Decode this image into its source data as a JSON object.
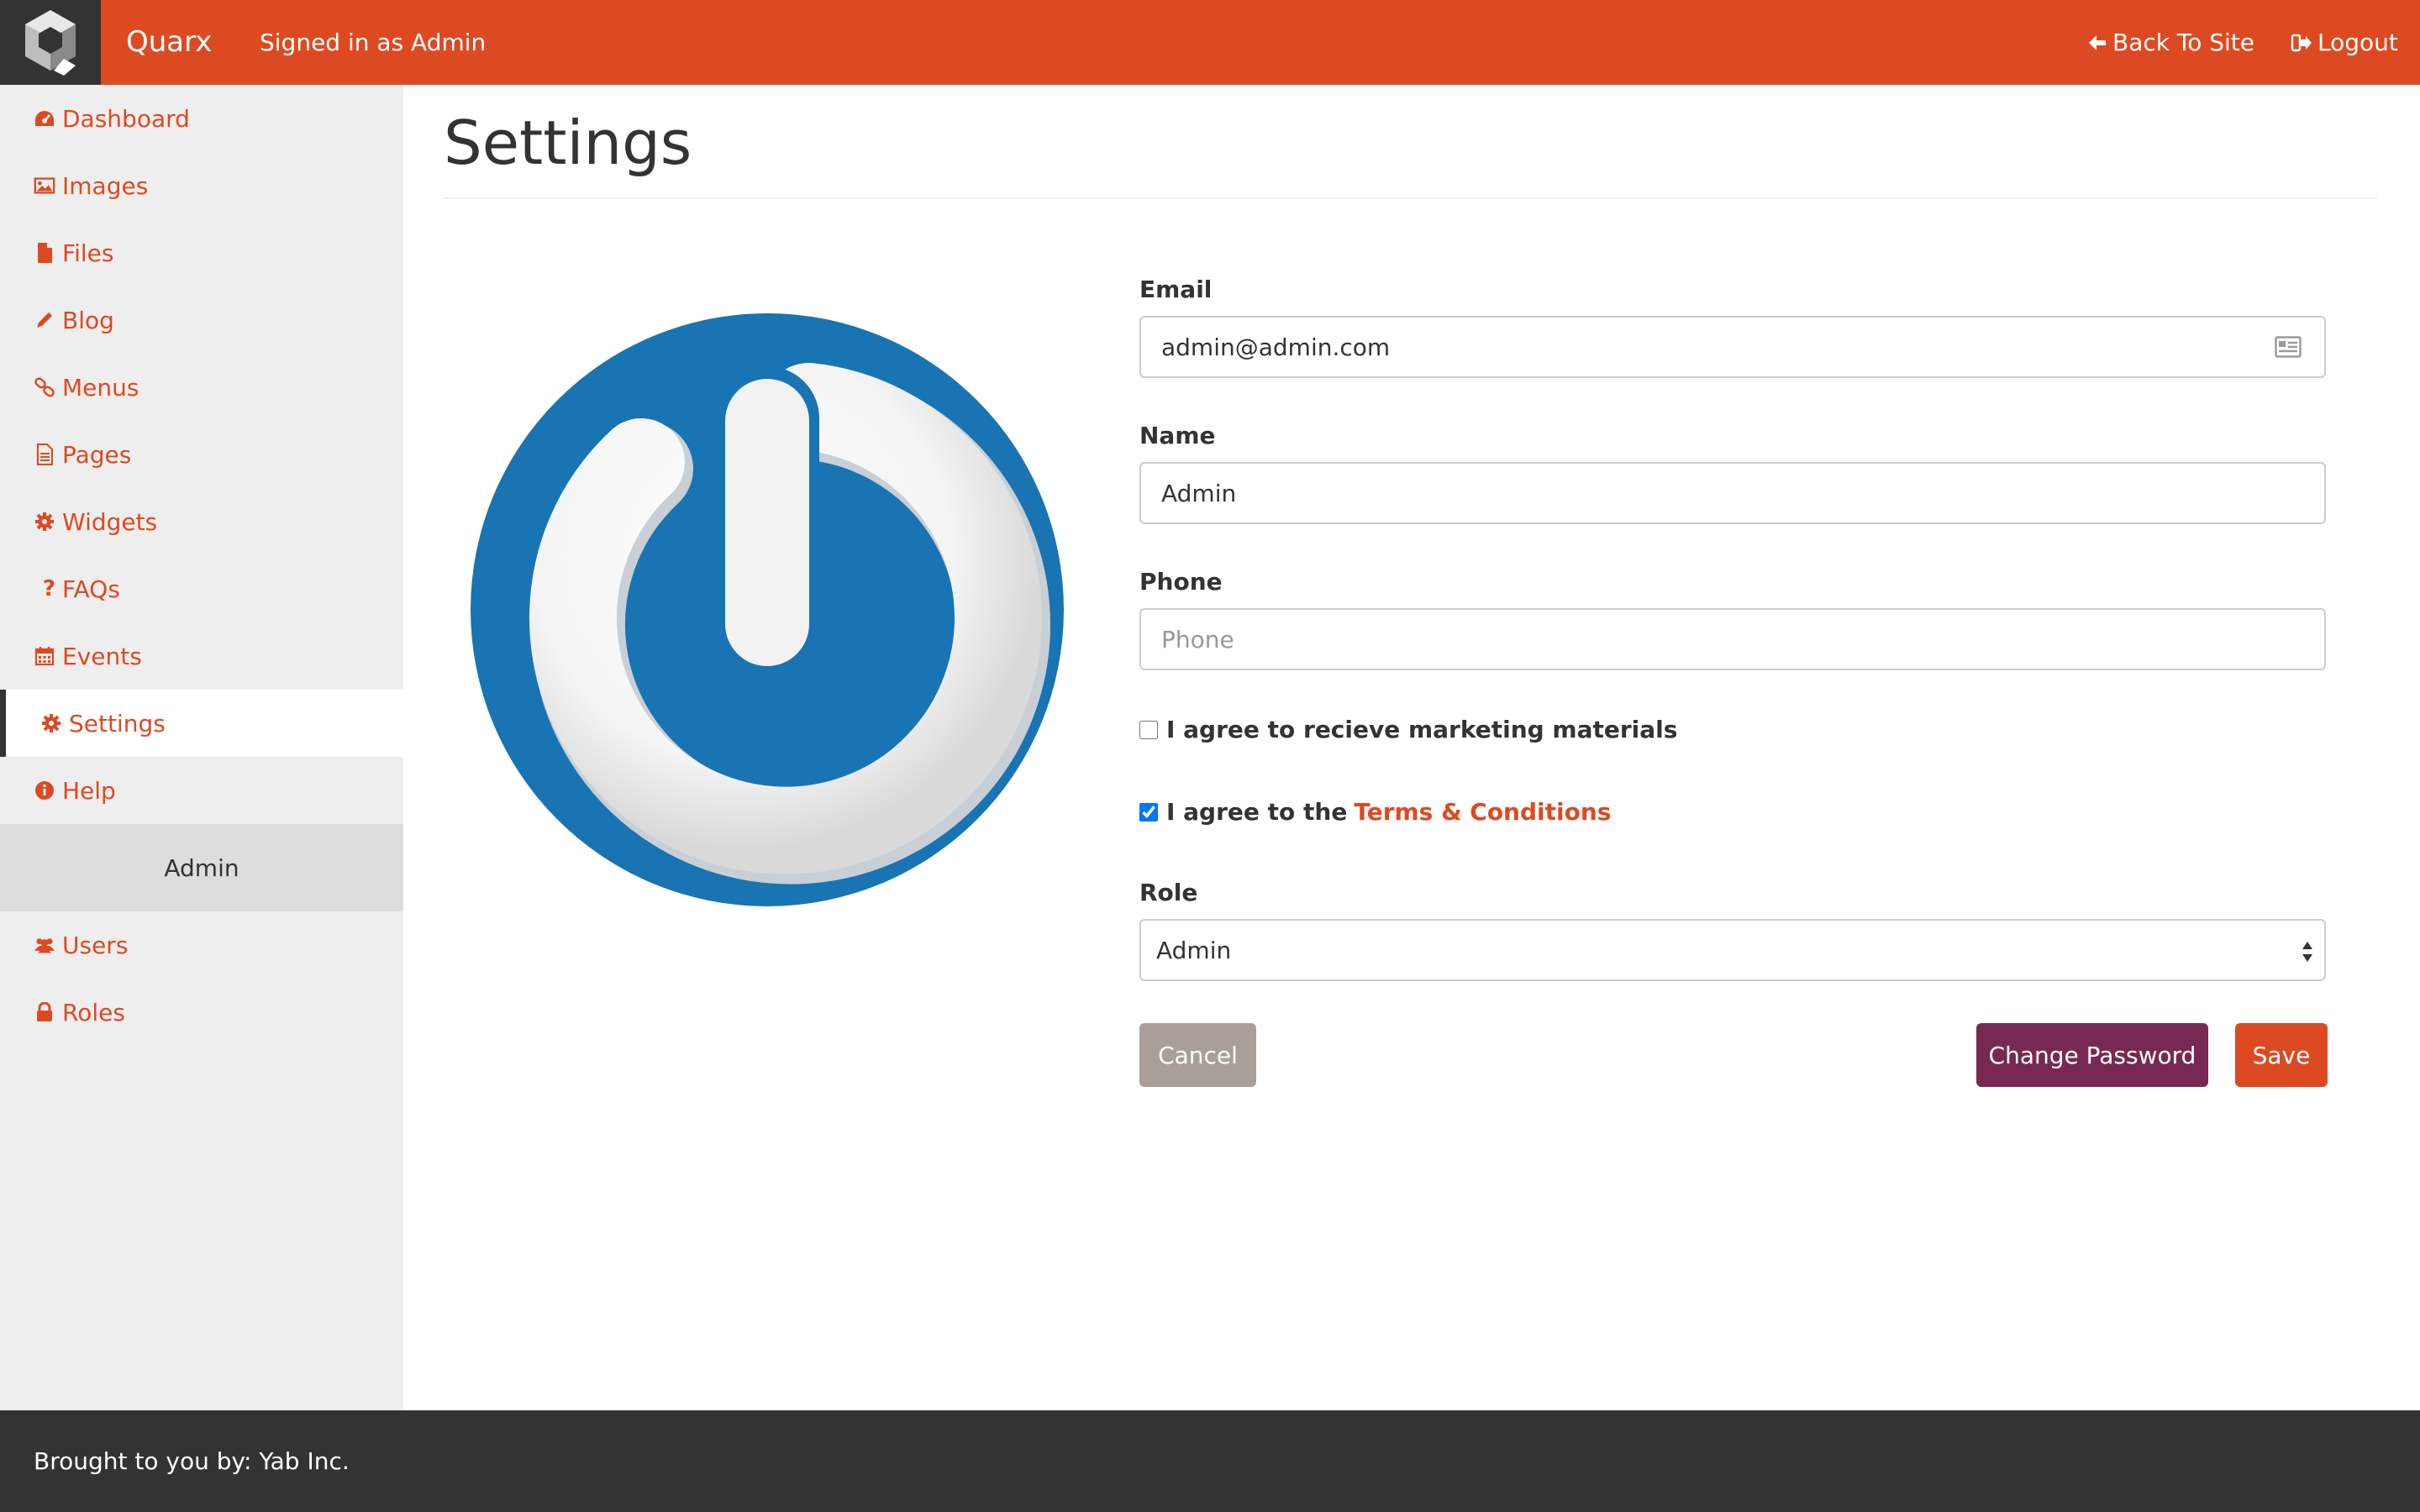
{
  "header": {
    "brand": "Quarx",
    "signed_in": "Signed in as Admin",
    "back_to_site": "Back To Site",
    "logout": "Logout"
  },
  "sidebar": {
    "items": [
      {
        "label": "Dashboard",
        "icon": "dashboard-icon"
      },
      {
        "label": "Images",
        "icon": "image-icon"
      },
      {
        "label": "Files",
        "icon": "file-icon"
      },
      {
        "label": "Blog",
        "icon": "pencil-icon"
      },
      {
        "label": "Menus",
        "icon": "link-icon"
      },
      {
        "label": "Pages",
        "icon": "page-icon"
      },
      {
        "label": "Widgets",
        "icon": "gear-icon"
      },
      {
        "label": "FAQs",
        "icon": "question-icon"
      },
      {
        "label": "Events",
        "icon": "calendar-icon"
      },
      {
        "label": "Settings",
        "icon": "gear-icon",
        "active": true
      },
      {
        "label": "Help",
        "icon": "info-icon"
      }
    ],
    "admin_section": "Admin",
    "admin_items": [
      {
        "label": "Users",
        "icon": "users-icon"
      },
      {
        "label": "Roles",
        "icon": "lock-icon"
      }
    ]
  },
  "main": {
    "title": "Settings",
    "form": {
      "email_label": "Email",
      "email_value": "admin@admin.com",
      "name_label": "Name",
      "name_value": "Admin",
      "phone_label": "Phone",
      "phone_placeholder": "Phone",
      "marketing_label": "I agree to recieve marketing materials",
      "marketing_checked": false,
      "terms_prefix": "I agree to the",
      "terms_link": "Terms & Conditions",
      "terms_checked": true,
      "role_label": "Role",
      "role_value": "Admin"
    },
    "buttons": {
      "cancel": "Cancel",
      "change_password": "Change Password",
      "save": "Save"
    }
  },
  "footer": {
    "text": "Brought to you by: Yab Inc."
  },
  "colors": {
    "accent": "#dd4a22",
    "dark": "#333333",
    "password_button": "#772953",
    "cancel_button": "#a99f98",
    "avatar_blue": "#1874b3"
  }
}
